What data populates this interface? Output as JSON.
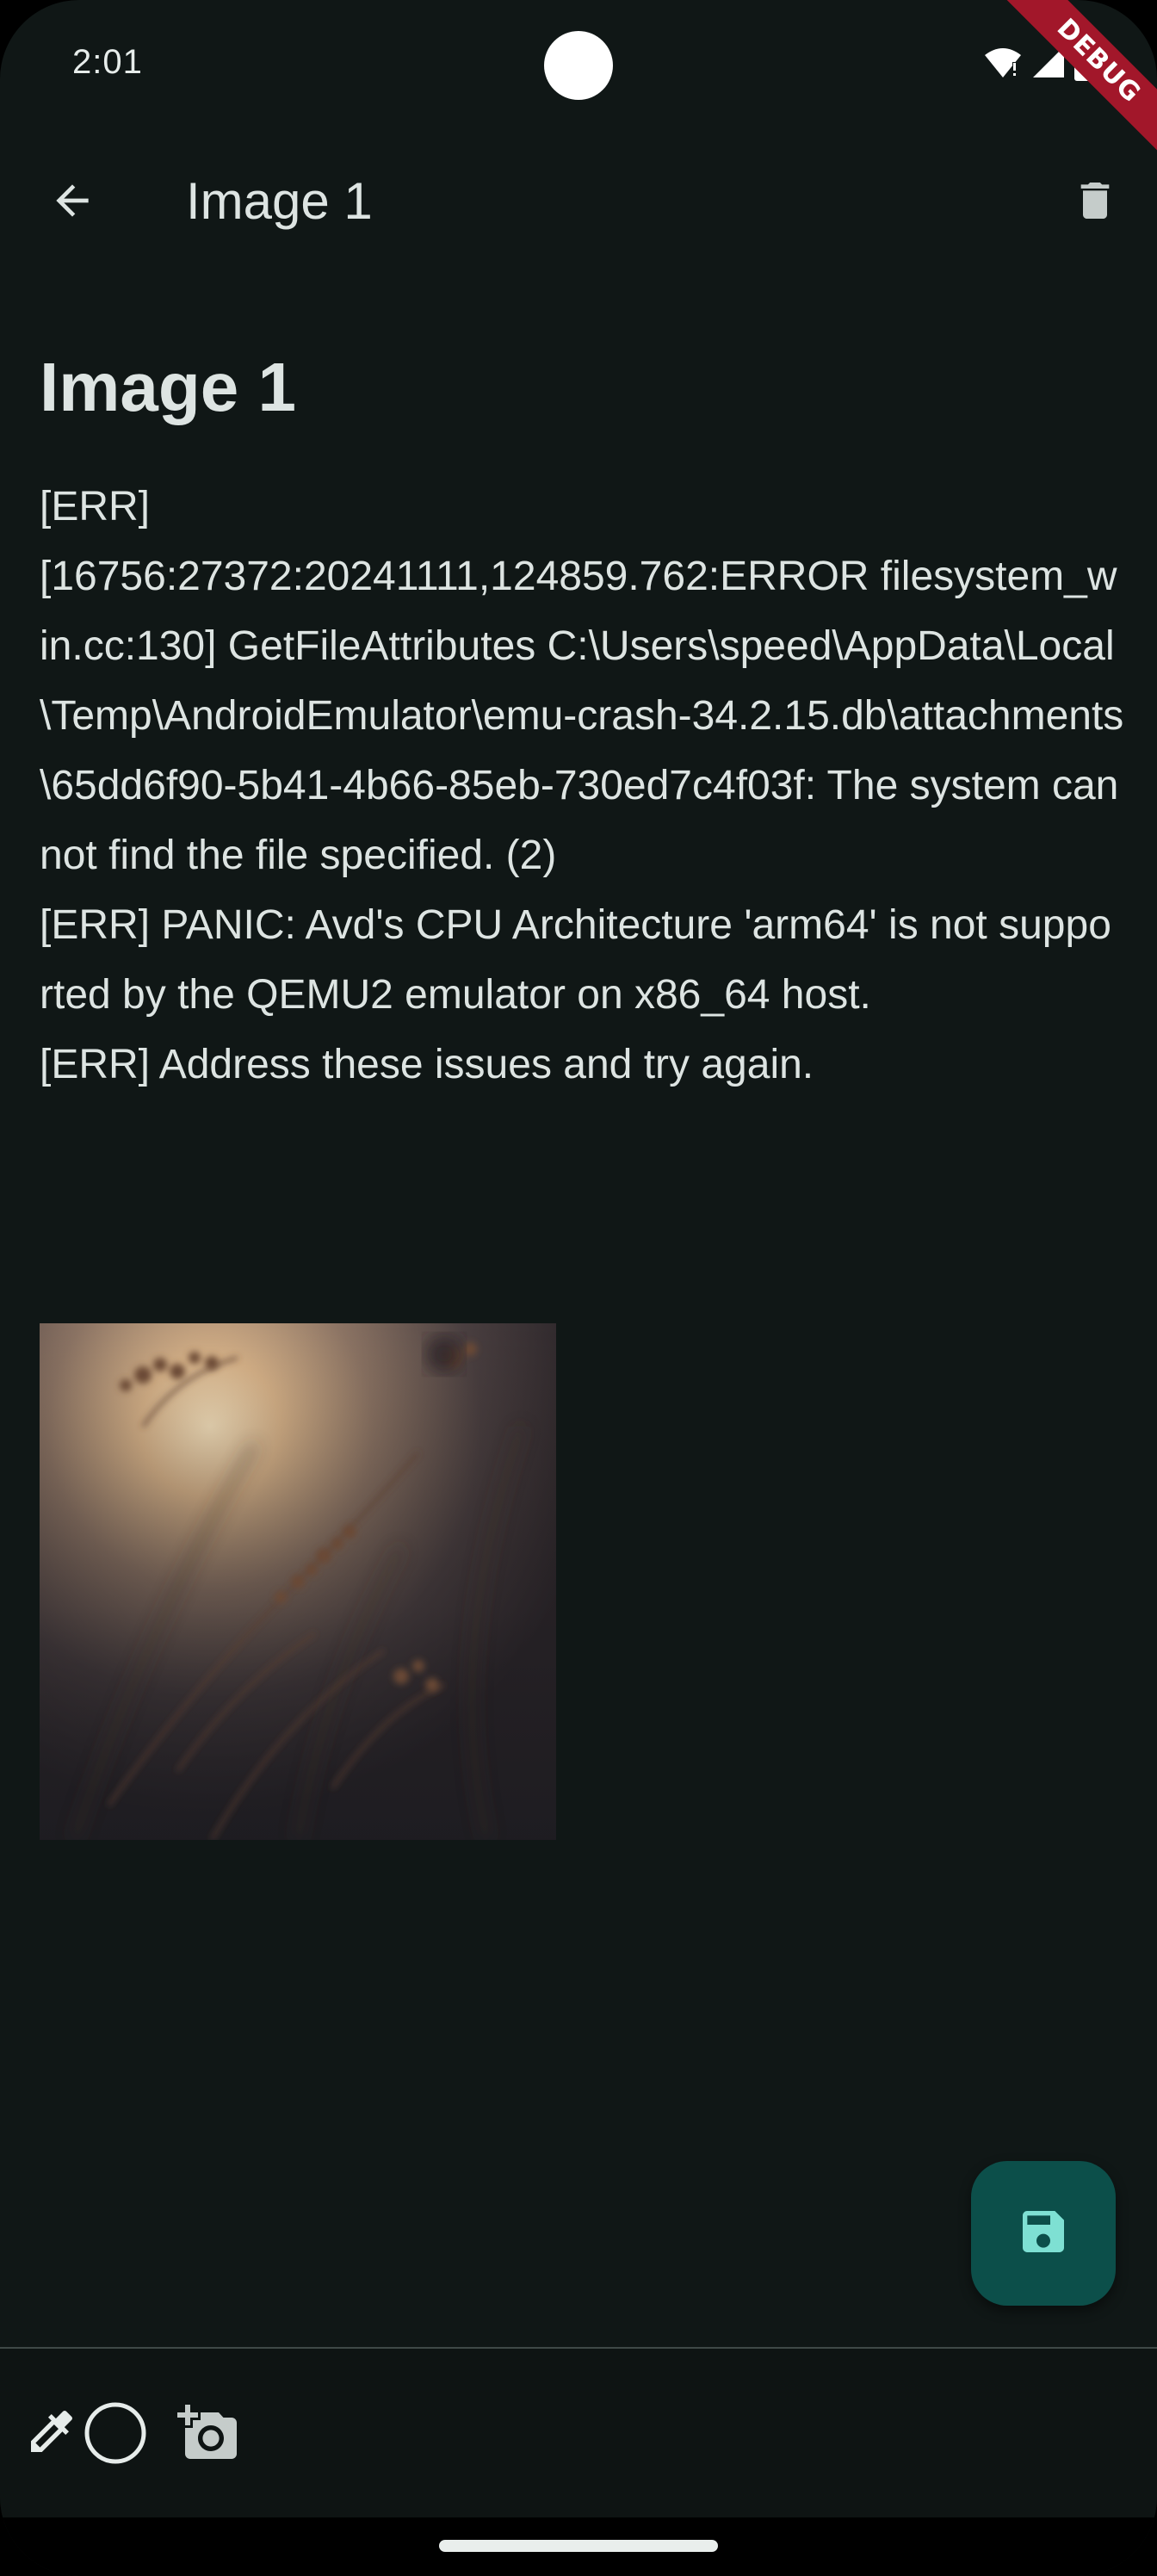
{
  "status_bar": {
    "time": "2:01",
    "debug_label": "DEBUG"
  },
  "app_bar": {
    "title": "Image 1",
    "back_icon": "arrow-back-icon",
    "delete_icon": "trash-icon"
  },
  "note": {
    "title": "Image 1",
    "body": "[ERR]\n[16756:27372:20241111,124859.762:ERROR filesystem_win.cc:130] GetFileAttributes C:\\Users\\speed\\AppData\\Local\\Temp\\AndroidEmulator\\emu-crash-34.2.15.db\\attachments\\65dd6f90-5b41-4b66-85eb-730ed7c4f03f: The system cannot find the file specified. (2)\n[ERR] PANIC: Avd's CPU Architecture 'arm64' is not supported by the QEMU2 emulator on x86_64 host.\n[ERR] Address these issues and try again.",
    "image_description_icon": "photo-dried-plants-sunset"
  },
  "fab": {
    "icon": "save-icon"
  },
  "toolbar": {
    "items": [
      "eyedropper-icon",
      "circle-icon",
      "add-photo-icon"
    ]
  },
  "colors": {
    "background": "#101716",
    "fab_background": "#0c4f4a",
    "fab_icon": "#7ee0d3",
    "text": "#dde4e2",
    "debug_ribbon": "#a2172a"
  }
}
